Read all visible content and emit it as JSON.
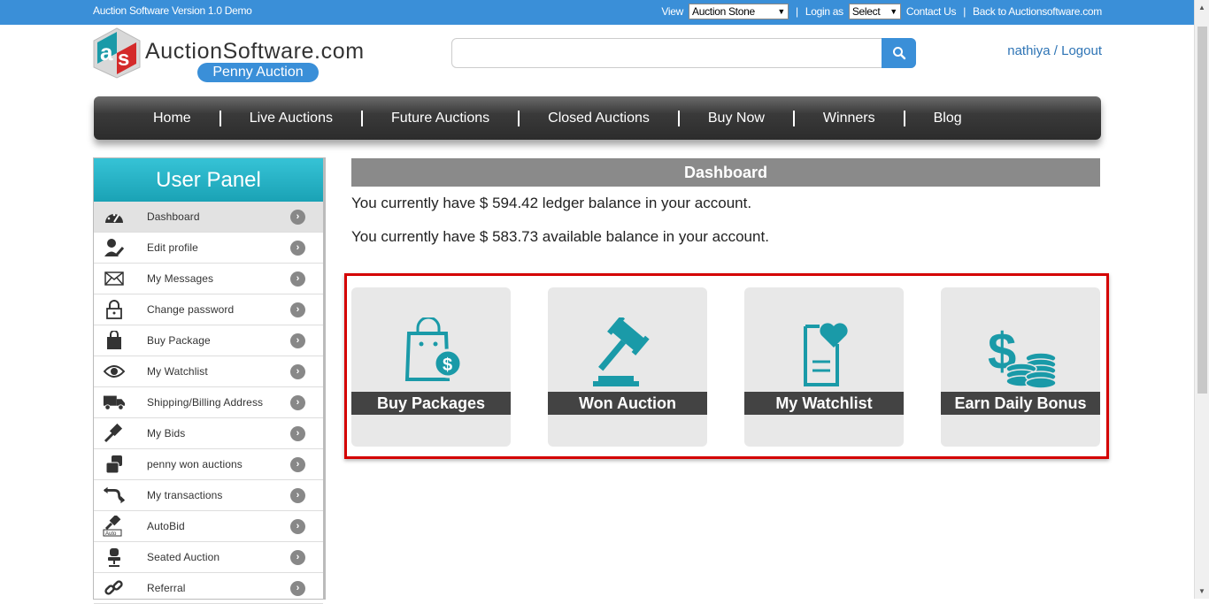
{
  "topbar": {
    "version": "Auction Software Version 1.0 Demo",
    "view_label": "View",
    "view_select": "Auction Stone",
    "login_as_label": "Login as",
    "login_as_select": "Select",
    "contact": "Contact Us",
    "back": "Back to Auctionsoftware.com",
    "separator": "|"
  },
  "logo": {
    "name": "AuctionSoftware.com",
    "tagline": "Penny Auction"
  },
  "search": {
    "placeholder": "",
    "value": ""
  },
  "user": {
    "text": "nathiya / Logout"
  },
  "nav": {
    "items": [
      "Home",
      "Live Auctions",
      "Future Auctions",
      "Closed Auctions",
      "Buy Now",
      "Winners",
      "Blog"
    ]
  },
  "panel": {
    "title": "User Panel",
    "items": [
      {
        "label": "Dashboard",
        "icon": "dashboard-icon"
      },
      {
        "label": "Edit profile",
        "icon": "user-edit-icon"
      },
      {
        "label": "My Messages",
        "icon": "envelope-icon"
      },
      {
        "label": "Change password",
        "icon": "lock-icon"
      },
      {
        "label": "Buy Package",
        "icon": "bag-icon"
      },
      {
        "label": "My Watchlist",
        "icon": "eye-icon"
      },
      {
        "label": "Shipping/Billing Address",
        "icon": "truck-icon"
      },
      {
        "label": "My Bids",
        "icon": "gavel-icon"
      },
      {
        "label": "penny won auctions",
        "icon": "coins-icon"
      },
      {
        "label": "My transactions",
        "icon": "exchange-icon"
      },
      {
        "label": "AutoBid",
        "icon": "autobid-icon"
      },
      {
        "label": "Seated Auction",
        "icon": "chair-icon"
      },
      {
        "label": "Referral",
        "icon": "link-icon"
      }
    ]
  },
  "dashboard": {
    "title": "Dashboard",
    "ledger": "You currently have $ 594.42 ledger balance in your account.",
    "available": "You currently have $ 583.73 available balance in your account.",
    "cards": [
      {
        "label": "Buy Packages"
      },
      {
        "label": "Won Auction"
      },
      {
        "label": "My Watchlist"
      },
      {
        "label": "Earn Daily Bonus"
      }
    ]
  },
  "colors": {
    "topbar": "#3a8fd8",
    "accent": "#1a9aa8",
    "highlight": "#d40000"
  }
}
